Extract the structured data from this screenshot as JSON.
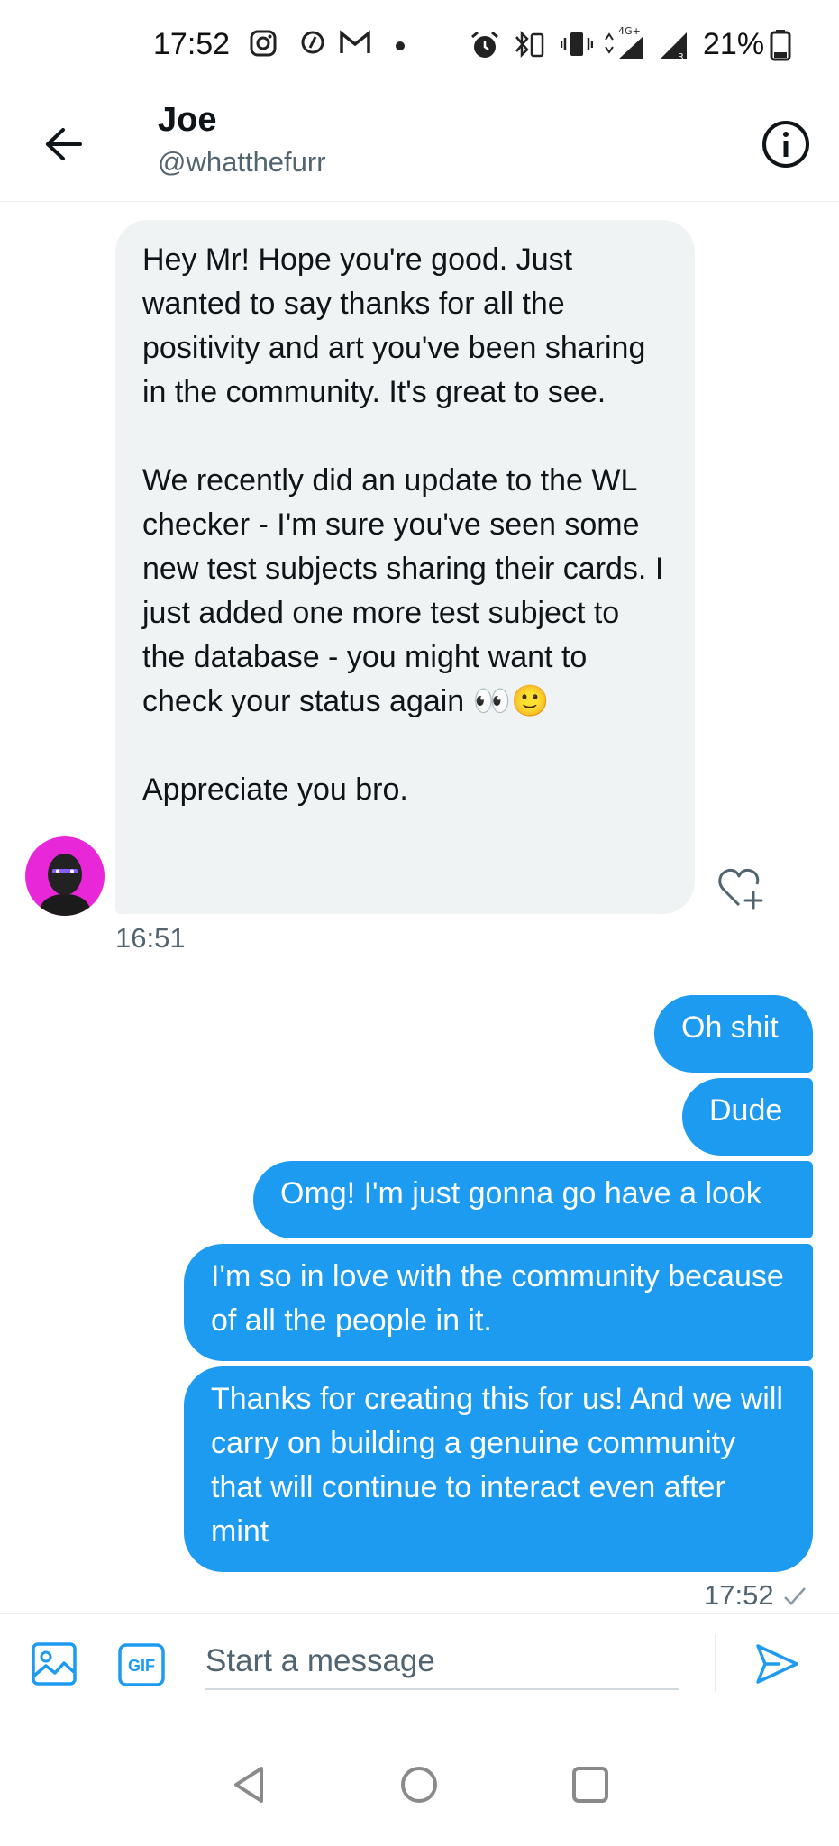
{
  "status_bar": {
    "time": "17:52",
    "network": "4G+",
    "battery": "21%"
  },
  "header": {
    "name": "Joe",
    "handle": "@whatthefurr"
  },
  "received_message": {
    "paragraphs": [
      "Hey Mr! Hope you're good. Just wanted to say thanks for all the positivity and art you've been sharing in the community. It's great to see.",
      "We recently did an update to the WL checker - I'm sure you've seen some new test subjects sharing their cards. I just added one more test subject to the database - you might want to check your status again 👀🙂",
      "Appreciate you bro."
    ],
    "timestamp": "16:51"
  },
  "sent_messages": [
    {
      "text": "Oh shit"
    },
    {
      "text": "Dude"
    },
    {
      "text": "Omg! I'm just gonna go have a look"
    },
    {
      "text": "I'm so in love with the community because of all the people in it."
    },
    {
      "text": "Thanks for creating this for us! And we will carry on building a genuine community that will continue to interact even after mint"
    }
  ],
  "sent_timestamp": "17:52",
  "composer": {
    "placeholder": "Start a message",
    "gif_label": "GIF"
  },
  "colors": {
    "accent": "#1d9bf0",
    "received_bubble": "#eff3f4",
    "avatar_bg": "#e828d8"
  }
}
